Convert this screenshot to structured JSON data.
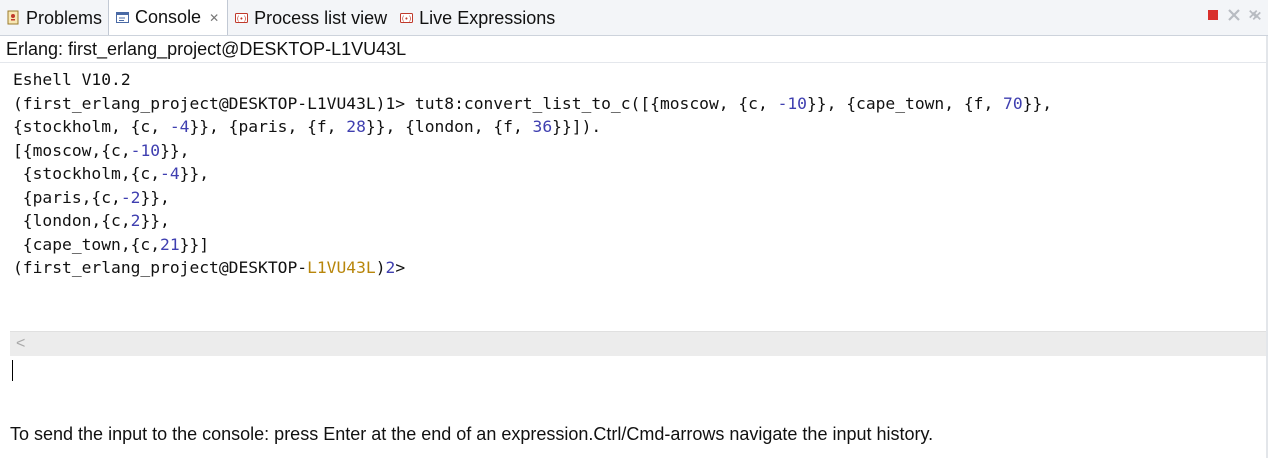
{
  "tabs": [
    {
      "label": "Problems",
      "icon": "problems-icon"
    },
    {
      "label": "Console",
      "icon": "console-icon",
      "active": true
    },
    {
      "label": "Process list view",
      "icon": "process-list-icon"
    },
    {
      "label": "Live Expressions",
      "icon": "live-expressions-icon"
    }
  ],
  "view_controls": [
    "stop-icon",
    "remove-launch-icon",
    "remove-all-icon"
  ],
  "subtitle": "Erlang: first_erlang_project@DESKTOP-L1VU43L",
  "console": {
    "lines": [
      "Eshell V10.2",
      "(first_erlang_project@DESKTOP-L1VU43L)1> tut8:convert_list_to_c([{moscow, {c, -10}}, {cape_town, {f, 70}},",
      "{stockholm, {c, -4}}, {paris, {f, 28}}, {london, {f, 36}}]).",
      "[{moscow,{c,-10}},",
      " {stockholm,{c,-4}},",
      " {paris,{c,-2}},",
      " {london,{c,2}},",
      " {cape_town,{c,21}}]",
      "(first_erlang_project@DESKTOP-L1VU43L)2>"
    ]
  },
  "input": {
    "value": ""
  },
  "hint": "To send the input to the console: press Enter at the end of an expression.Ctrl/Cmd-arrows navigate the input history.",
  "colors": {
    "number": "#3f3fb0",
    "highlight": "#b8860b",
    "tab_bar": "#f3f5f8"
  }
}
